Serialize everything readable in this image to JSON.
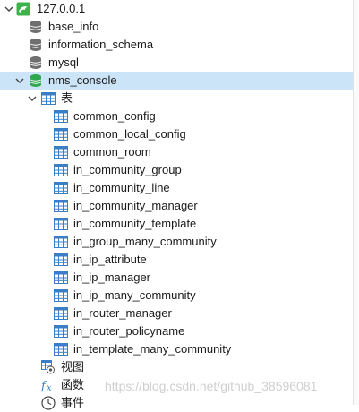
{
  "connection": {
    "name": "127.0.0.1",
    "icon": "dolphin-icon"
  },
  "databases": [
    {
      "name": "base_info"
    },
    {
      "name": "information_schema"
    },
    {
      "name": "mysql"
    },
    {
      "name": "nms_console"
    }
  ],
  "selected_database": "nms_console",
  "tables_folder": {
    "label": "表"
  },
  "tables": [
    "common_config",
    "common_local_config",
    "common_room",
    "in_community_group",
    "in_community_line",
    "in_community_manager",
    "in_community_template",
    "in_group_many_community",
    "in_ip_attribute",
    "in_ip_manager",
    "in_ip_many_community",
    "in_router_manager",
    "in_router_policyname",
    "in_template_many_community"
  ],
  "views_folder": {
    "label": "视图"
  },
  "functions_folder": {
    "label": "函数"
  },
  "events_folder": {
    "label": "事件"
  },
  "watermark": "https://blog.csdn.net/github_38596081",
  "colors": {
    "selection": "#cce4f7",
    "db_gray": "#6f6f6f",
    "db_green": "#2fa84f",
    "table_blue": "#3a7fc6",
    "connection_green": "#3db24a"
  }
}
